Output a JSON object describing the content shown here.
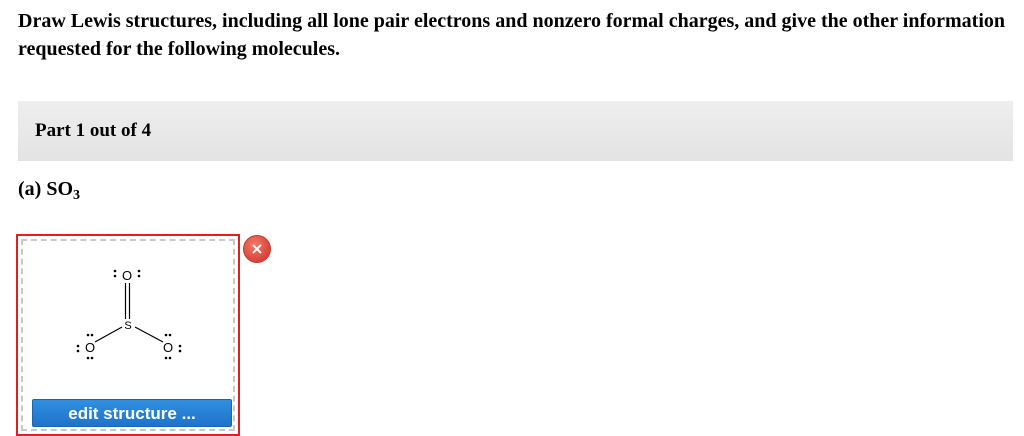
{
  "instructions": "Draw Lewis structures, including all lone pair electrons and nonzero formal charges, and give the other information requested for the following molecules.",
  "part": {
    "label": "Part 1 out of 4"
  },
  "question": {
    "prefix": "(a) SO",
    "subscript": "3"
  },
  "editor": {
    "edit_label": "edit structure ...",
    "close_glyph": "×",
    "molecule": {
      "atoms": [
        "O",
        "S",
        "O",
        "O"
      ]
    }
  },
  "colors": {
    "editor_border": "#e02020",
    "button_bg": "#1f78d1",
    "close_bg": "#d9443a",
    "part_bar_bg": "#e8e8e8"
  }
}
